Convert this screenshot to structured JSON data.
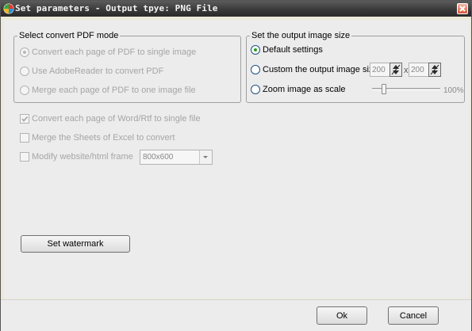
{
  "window": {
    "title": "Set parameters - Output tpye: PNG File",
    "app_icon": "app-logo-icon",
    "close_icon": "close-icon"
  },
  "pdf_mode": {
    "legend": "Select convert PDF mode",
    "options": [
      {
        "label": "Convert each page of PDF to single image",
        "selected": true,
        "enabled": false
      },
      {
        "label": "Use AdobeReader to convert PDF",
        "selected": false,
        "enabled": false
      },
      {
        "label": "Merge each page of PDF to one image file",
        "selected": false,
        "enabled": false
      }
    ]
  },
  "output_size": {
    "legend": "Set the output image size",
    "default_label": "Default settings",
    "custom_label": "Custom the output image size",
    "width_value": "200",
    "height_value": "200",
    "times_label": "x",
    "zoom_label": "Zoom image as scale",
    "zoom_percent": "100%",
    "zoom_level": 0.15,
    "selected": "default"
  },
  "options": {
    "word_rtf_label": "Convert each page of Word/Rtf to single file",
    "word_rtf_checked": true,
    "excel_label": "Merge the Sheets of Excel to convert",
    "excel_checked": false,
    "web_frame_label": "Modify website/html frame",
    "web_frame_checked": false,
    "web_frame_value": "800x600"
  },
  "buttons": {
    "watermark": "Set watermark",
    "ok": "Ok",
    "cancel": "Cancel"
  },
  "colors": {
    "title_bar": "#3a3a3a",
    "selected_dot": "#21a121",
    "radio_border": "#1c5180"
  }
}
